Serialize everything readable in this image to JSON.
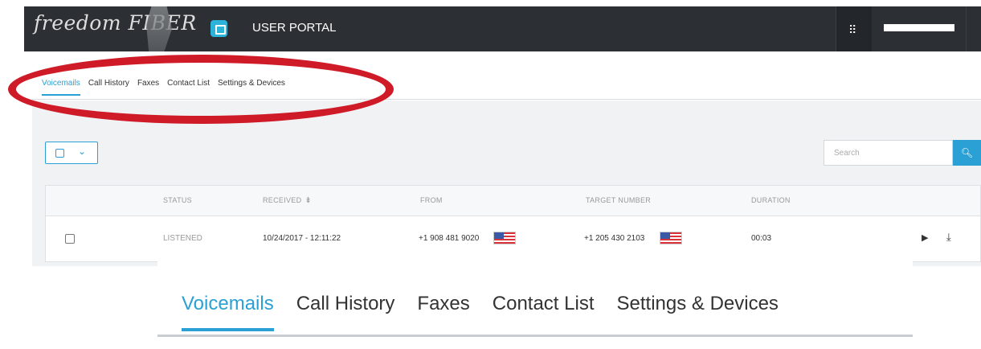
{
  "header": {
    "logo_text": "freedom FIBER",
    "portal_title": "USER PORTAL",
    "apps_icon": "grid-icon"
  },
  "nav": {
    "tabs": [
      {
        "label": "Voicemails",
        "active": true
      },
      {
        "label": "Call History",
        "active": false
      },
      {
        "label": "Faxes",
        "active": false
      },
      {
        "label": "Contact List",
        "active": false
      },
      {
        "label": "Settings & Devices",
        "active": false
      }
    ]
  },
  "toolbar": {
    "search_placeholder": "Search",
    "search_icon": "magnifier-icon"
  },
  "table": {
    "columns": [
      "STATUS",
      "RECEIVED",
      "FROM",
      "TARGET NUMBER",
      "DURATION"
    ],
    "rows": [
      {
        "status": "LISTENED",
        "received": "10/24/2017 - 12:11:22",
        "from": "+1 908 481 9020",
        "target": "+1 205 430 2103",
        "duration": "00:03"
      }
    ]
  },
  "zoomed_nav": {
    "tabs": [
      {
        "label": "Voicemails",
        "active": true
      },
      {
        "label": "Call History",
        "active": false
      },
      {
        "label": "Faxes",
        "active": false
      },
      {
        "label": "Contact List",
        "active": false
      },
      {
        "label": "Settings & Devices",
        "active": false
      }
    ]
  },
  "colors": {
    "accent": "#2aa0d4",
    "header_bg": "#2c2f33",
    "annotation_red": "#cf1b27"
  }
}
